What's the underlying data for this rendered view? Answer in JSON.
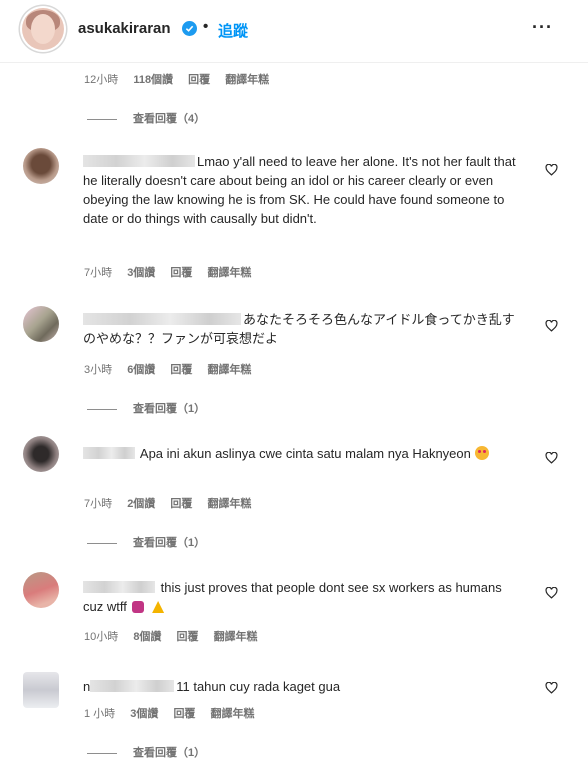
{
  "header": {
    "username": "asukakiraran",
    "separator": "•",
    "follow_label": "追蹤",
    "more_label": "···"
  },
  "top_meta": {
    "time": "12小時",
    "likes": "118個讚",
    "reply": "回覆",
    "translate": "翻譯年糕"
  },
  "top_replies": {
    "label": "查看回覆（4）"
  },
  "comments": [
    {
      "text": "Lmao y'all need to leave her alone. It's not her fault that he literally doesn't care about being an idol or his career clearly or even obeying the law knowing he is from SK. He could have found someone to date or do things with causally but didn't.",
      "time": "7小時",
      "likes": "3個讚",
      "reply": "回覆",
      "translate": "翻譯年糕"
    },
    {
      "text": "あなたそろそろ色んなアイドル食ってかき乱すのやめな？？ファンが可哀想だよ",
      "time": "3小時",
      "likes": "6個讚",
      "reply": "回覆",
      "translate": "翻譯年糕",
      "replies": "查看回覆（1）"
    },
    {
      "text": "Apa ini akun aslinya cwe cinta satu malam nya Haknyeon",
      "time": "7小時",
      "likes": "2個讚",
      "reply": "回覆",
      "translate": "翻譯年糕",
      "replies": "查看回覆（1）"
    },
    {
      "text": "this just proves that people dont see sx workers as humans cuz wtff",
      "time": "10小時",
      "likes": "8個讚",
      "reply": "回覆",
      "translate": "翻譯年糕"
    },
    {
      "name_prefix": "n",
      "text": "11 tahun cuy rada kaget gua",
      "time": "1 小時",
      "likes": "3個讚",
      "reply": "回覆",
      "translate": "翻譯年糕",
      "replies": "查看回覆（1）"
    }
  ]
}
